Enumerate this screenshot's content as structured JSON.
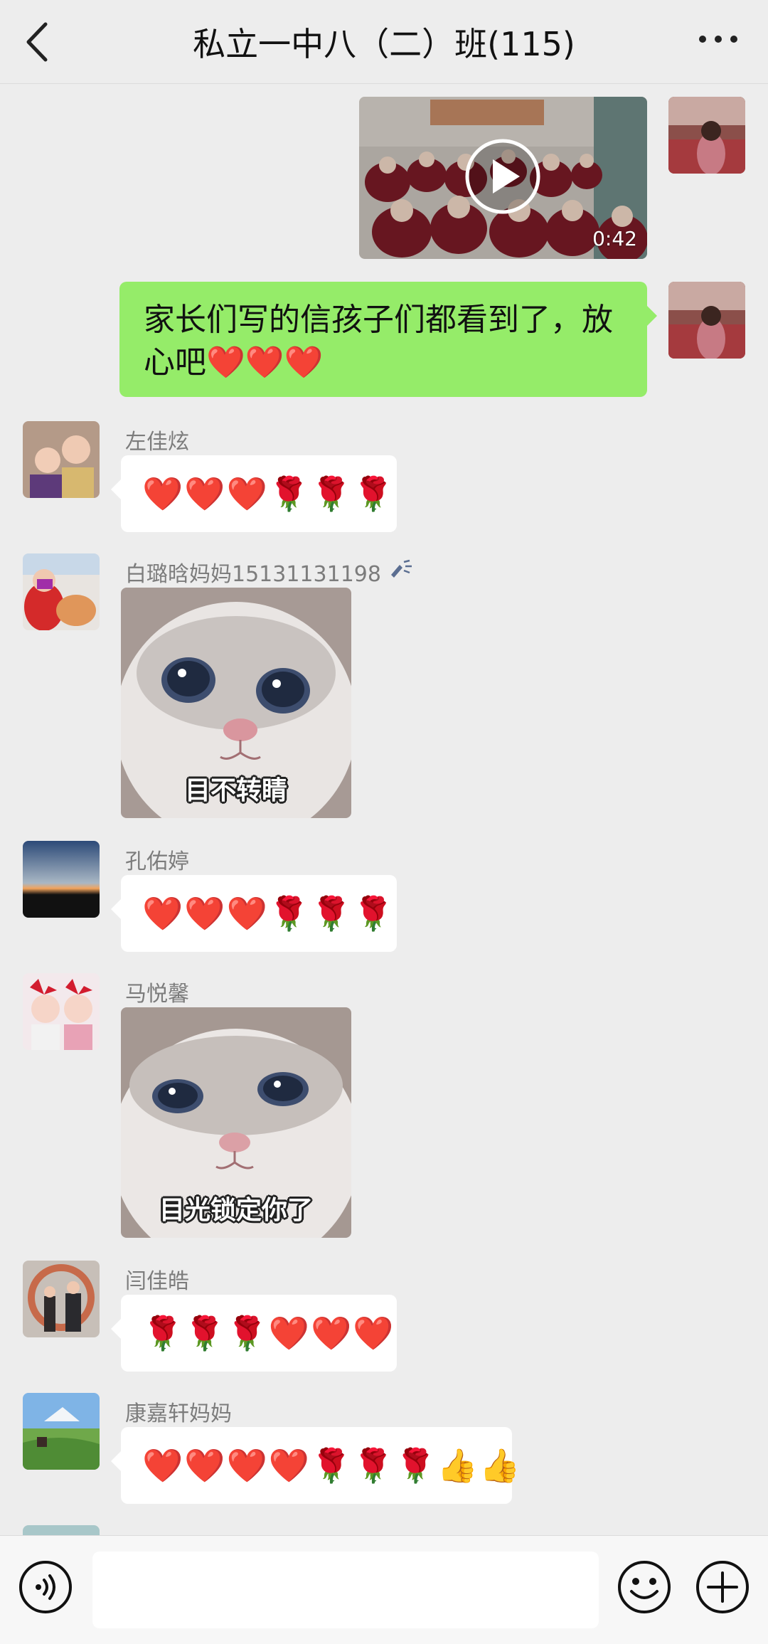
{
  "header": {
    "title": "私立一中八（二）班(115)"
  },
  "video": {
    "duration": "0:42"
  },
  "outgoing_text": "家长们写的信孩子们都看到了，放心吧❤️❤️❤️",
  "messages": [
    {
      "name": "左佳炫",
      "content": "❤️❤️❤️🌹🌹🌹"
    },
    {
      "name": "白璐晗妈妈15131131198",
      "sticker_caption": "目不转睛"
    },
    {
      "name": "孔佑婷",
      "content": "❤️❤️❤️🌹🌹🌹"
    },
    {
      "name": "马悦馨",
      "sticker_caption": "目光锁定你了"
    },
    {
      "name": "闫佳皓",
      "content": "🌹🌹🌹❤️❤️❤️"
    },
    {
      "name": "康嘉轩妈妈",
      "content": "❤️❤️❤️❤️🌹🌹🌹👍👍"
    }
  ],
  "icons": {
    "back": "chevron-left-icon",
    "more": "more-dots-icon",
    "voice": "voice-icon",
    "emoji": "emoji-icon",
    "add": "plus-icon"
  },
  "colors": {
    "self_bubble": "#95ec69",
    "other_bubble": "#ffffff",
    "background": "#ededed"
  }
}
